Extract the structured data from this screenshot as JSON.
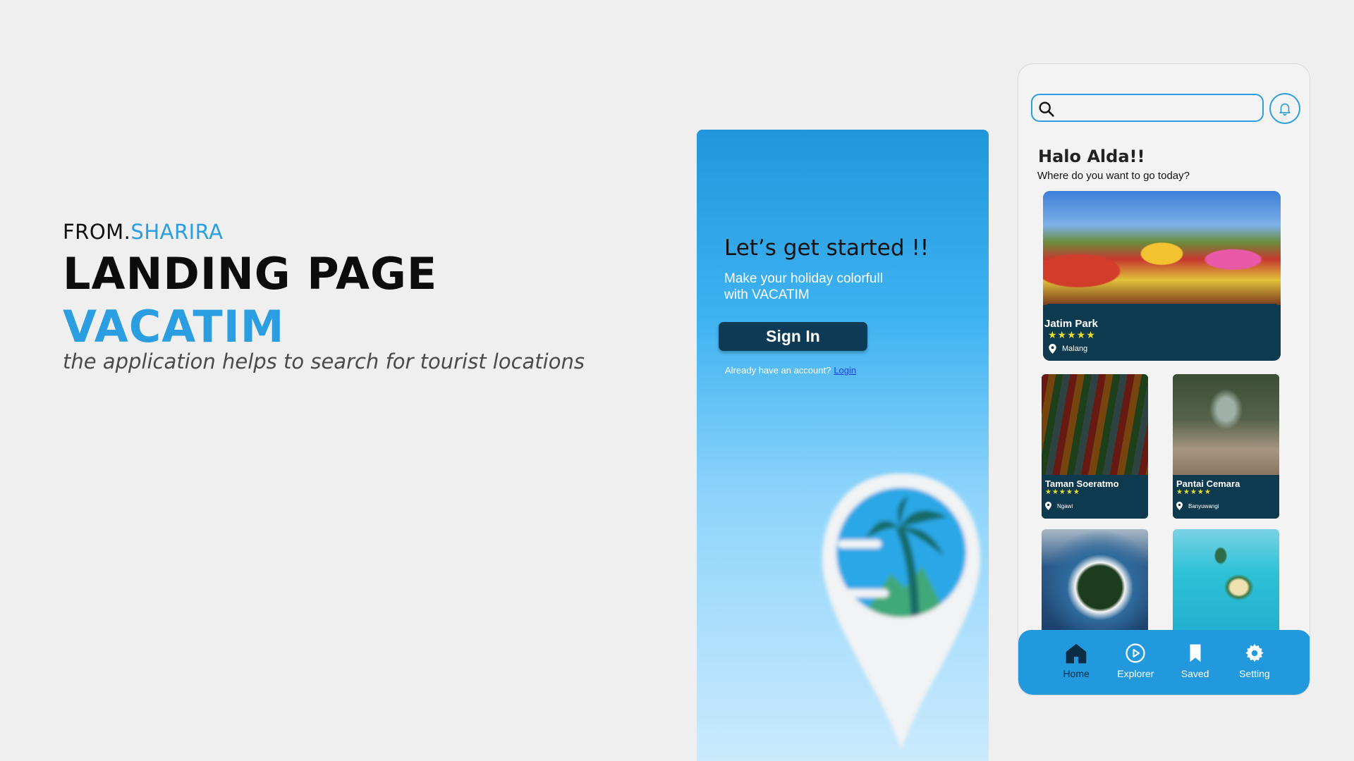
{
  "hero": {
    "from_prefix": "FROM.",
    "author": "SHARIRA",
    "title": "LANDING PAGE",
    "brand": "VACATIM",
    "description": "the application helps to search for tourist locations"
  },
  "landing": {
    "heading": "Let’s get started !!",
    "subtitle": "Make your holiday colorfull with VACATIM",
    "signin_label": "Sign In",
    "account_prompt": "Already have an account?",
    "login_link": "Login"
  },
  "home": {
    "search": {
      "placeholder": ""
    },
    "greeting": "Halo Alda!!",
    "greeting_sub": "Where do you want to go today?",
    "featured": {
      "name": "Jatim Park",
      "stars": "★★★★★",
      "location": "Malang"
    },
    "places": [
      {
        "name": "Taman Soeratmo",
        "stars": "★★★★★",
        "location": "Ngawi"
      },
      {
        "name": "Pantai Cemara",
        "stars": "★★★★★",
        "location": "Banyuwangi"
      }
    ],
    "nav": [
      {
        "label": "Home",
        "icon": "home-icon"
      },
      {
        "label": "Explorer",
        "icon": "play-circle-icon"
      },
      {
        "label": "Saved",
        "icon": "bookmark-icon"
      },
      {
        "label": "Setting",
        "icon": "gear-icon"
      }
    ]
  },
  "colors": {
    "accent": "#2a9ee0",
    "dark_navy": "#0e3a4f",
    "star_yellow": "#e6de2b",
    "background": "#efefef"
  }
}
